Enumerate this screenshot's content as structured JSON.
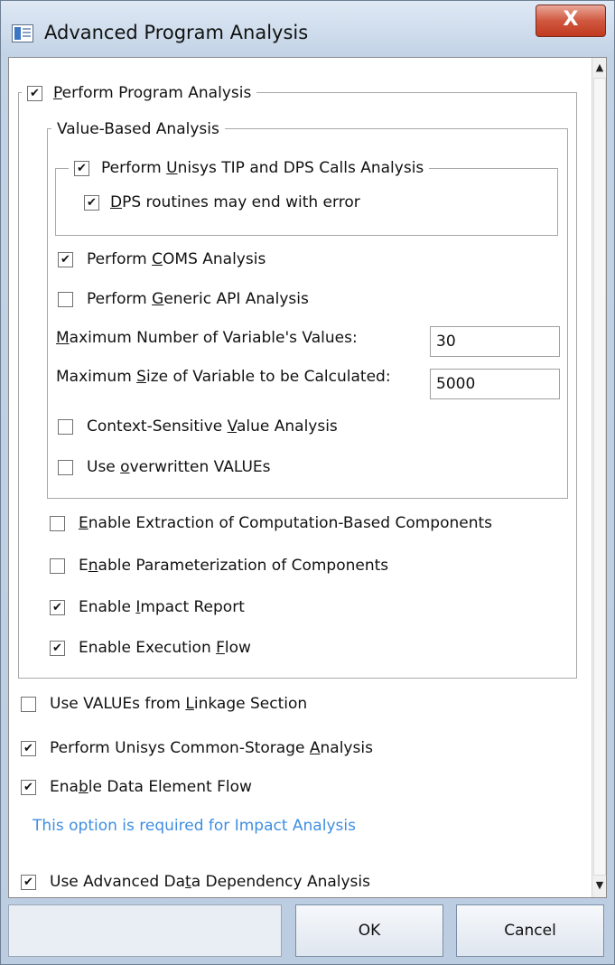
{
  "window": {
    "title": "Advanced Program Analysis",
    "close_label": "X"
  },
  "groups": {
    "perform_program_analysis": {
      "label_pre": "",
      "label_u": "P",
      "label_post": "erform Program Analysis",
      "checked": true
    },
    "value_based": {
      "label": "Value-Based Analysis"
    },
    "tip_dps": {
      "label_pre": "Perform ",
      "label_u": "U",
      "label_post": "nisys TIP and DPS Calls Analysis",
      "checked": true
    }
  },
  "options": {
    "dps_error": {
      "pre": "",
      "u": "D",
      "post": "PS routines may end with error",
      "checked": true
    },
    "coms": {
      "pre": "Perform ",
      "u": "C",
      "post": "OMS Analysis",
      "checked": true
    },
    "generic_api": {
      "pre": "Perform ",
      "u": "G",
      "post": "eneric API Analysis",
      "checked": false
    },
    "context_sensitive": {
      "pre": "Context-Sensitive ",
      "u": "V",
      "post": "alue Analysis",
      "checked": false
    },
    "overwritten": {
      "pre": "Use ",
      "u": "o",
      "post": "verwritten VALUEs",
      "checked": false
    },
    "computation": {
      "pre": "",
      "u": "E",
      "post": "nable Extraction of Computation-Based Components",
      "checked": false
    },
    "parameterization": {
      "pre": "E",
      "u": "n",
      "post": "able Parameterization of Components",
      "checked": false
    },
    "impact_report": {
      "pre": "Enable ",
      "u": "I",
      "post": "mpact Report",
      "checked": true
    },
    "execution_flow": {
      "pre": "Enable Execution ",
      "u": "F",
      "post": "low",
      "checked": true
    },
    "linkage": {
      "pre": "Use VALUEs from ",
      "u": "L",
      "post": "inkage Section",
      "checked": false
    },
    "common_storage": {
      "pre": "Perform Unisys Common-Storage ",
      "u": "A",
      "post": "nalysis",
      "checked": true
    },
    "data_element_flow": {
      "pre": "Ena",
      "u": "b",
      "post": "le Data Element Flow",
      "checked": true
    },
    "advanced_dependency": {
      "pre": "Use Advanced Da",
      "u": "t",
      "post": "a Dependency Analysis",
      "checked": true
    }
  },
  "fields": {
    "max_values": {
      "pre": "",
      "u": "M",
      "post": "aximum Number of Variable's Values:",
      "value": "30"
    },
    "max_size": {
      "pre": "Maximum ",
      "u": "S",
      "post": "ize of Variable to be Calculated:",
      "value": "5000"
    }
  },
  "note": "This option is required for Impact Analysis",
  "buttons": {
    "ok": "OK",
    "cancel": "Cancel"
  },
  "colors": {
    "note": "#3e8ee0",
    "close": "#c03a20"
  }
}
